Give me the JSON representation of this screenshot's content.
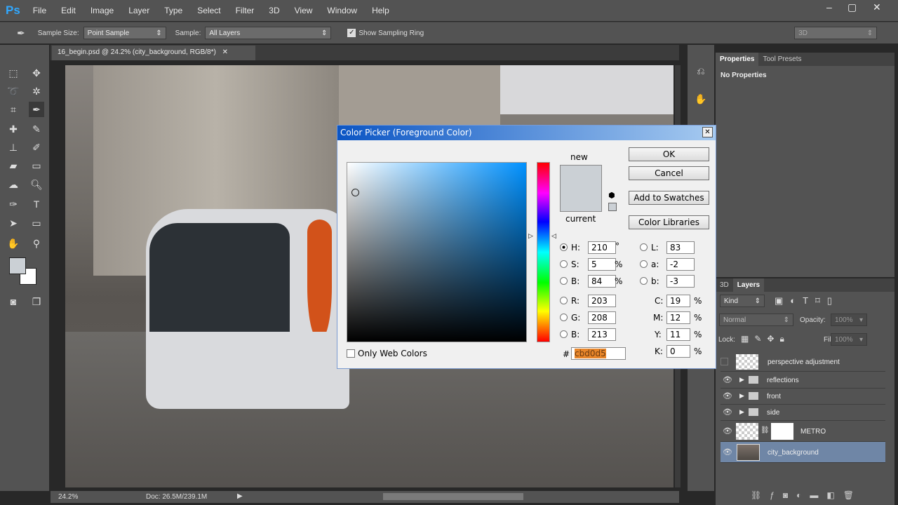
{
  "app": {
    "logo": "Ps",
    "menu": [
      "File",
      "Edit",
      "Image",
      "Layer",
      "Type",
      "Select",
      "Filter",
      "3D",
      "View",
      "Window",
      "Help"
    ]
  },
  "options": {
    "sample_size_label": "Sample Size:",
    "sample_size": "Point Sample",
    "sample_label": "Sample:",
    "sample": "All Layers",
    "ring_label": "Show Sampling Ring",
    "workspace": "3D"
  },
  "document": {
    "tab": "16_begin.psd @ 24.2% (city_background, RGB/8*)",
    "zoom": "24.2%",
    "doc_info": "Doc: 26.5M/239.1M"
  },
  "properties": {
    "tabs": [
      "Properties",
      "Tool Presets"
    ],
    "content": "No Properties"
  },
  "layers_panel": {
    "tabs": [
      "3D",
      "Layers"
    ],
    "kind": "Kind",
    "blend": "Normal",
    "opacity_label": "Opacity:",
    "opacity": "100%",
    "lock_label": "Lock:",
    "fill_label": "Fill:",
    "fill": "100%",
    "layers": [
      {
        "name": "perspective adjustment",
        "visible": false
      },
      {
        "name": "reflections",
        "visible": true
      },
      {
        "name": "front",
        "visible": true
      },
      {
        "name": "side",
        "visible": true
      },
      {
        "name": "METRO",
        "visible": true
      },
      {
        "name": "city_background",
        "visible": true,
        "selected": true
      }
    ]
  },
  "color_picker": {
    "title": "Color Picker (Foreground Color)",
    "ok": "OK",
    "cancel": "Cancel",
    "add_swatches": "Add to Swatches",
    "libraries": "Color Libraries",
    "new_label": "new",
    "current_label": "current",
    "only_web": "Only Web Colors",
    "fields": {
      "H": "210",
      "S": "5",
      "Bv": "84",
      "R": "203",
      "G": "208",
      "B": "213",
      "L": "83",
      "a": "-2",
      "b": "-3",
      "C": "19",
      "M": "12",
      "Y": "11",
      "K": "0"
    },
    "units": {
      "deg": "°",
      "pct": "%"
    },
    "labels": {
      "H": "H:",
      "S": "S:",
      "Bv": "B:",
      "R": "R:",
      "G": "G:",
      "B": "B:",
      "L": "L:",
      "a": "a:",
      "b": "b:",
      "C": "C:",
      "M": "M:",
      "Y": "Y:",
      "K": "K:",
      "hash": "#"
    },
    "hex": "cbd0d5",
    "color": "#cbd0d5"
  }
}
